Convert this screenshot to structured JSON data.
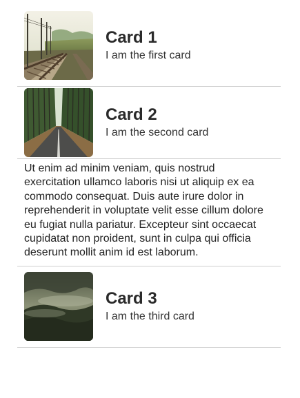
{
  "cards": [
    {
      "title": "Card 1",
      "subtitle": "I am the first card",
      "image": "railway-tracks-photo"
    },
    {
      "title": "Card 2",
      "subtitle": "I am the second card",
      "image": "forest-road-photo",
      "expanded_text": "Ut enim ad minim veniam, quis nostrud exercitation ullamco laboris nisi ut aliquip ex ea commodo consequat. Duis aute irure dolor in reprehenderit in voluptate velit esse cillum dolore eu fugiat nulla pariatur. Excepteur sint occaecat cupidatat non proident, sunt in culpa qui officia deserunt mollit anim id est laborum."
    },
    {
      "title": "Card 3",
      "subtitle": "I am the third card",
      "image": "misty-forest-photo"
    }
  ]
}
